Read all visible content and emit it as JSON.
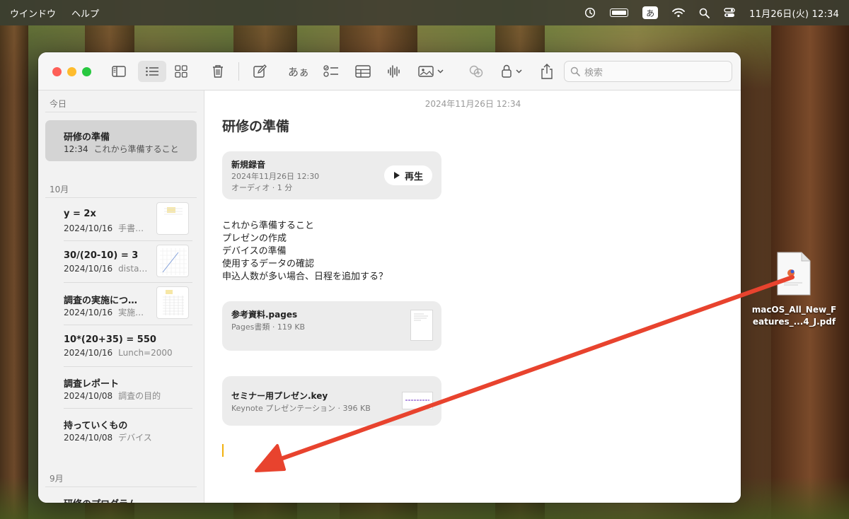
{
  "menubar": {
    "items": [
      "ウインドウ",
      "ヘルプ"
    ],
    "ime": "あ",
    "clock": "11月26日(火)  12:34"
  },
  "toolbar": {
    "format_label": "あぁ",
    "search_placeholder": "検索"
  },
  "sidebar": {
    "sections": {
      "today": "今日",
      "october": "10月",
      "september": "9月"
    },
    "selected_note": {
      "title": "研修の準備",
      "time": "12:34",
      "preview": "これから準備すること"
    },
    "october_notes": [
      {
        "title": "y = 2x",
        "date": "2024/10/16",
        "preview": "手書…"
      },
      {
        "title": "30/(20-10) = 3",
        "date": "2024/10/16",
        "preview": "dista…"
      },
      {
        "title": "調査の実施につ…",
        "date": "2024/10/16",
        "preview": "実施…"
      },
      {
        "title": "10*(20+35) = 550",
        "date": "2024/10/16",
        "preview": "Lunch=2000"
      },
      {
        "title": "調査レポート",
        "date": "2024/10/08",
        "preview": "調査の目的"
      },
      {
        "title": "持っていくもの",
        "date": "2024/10/08",
        "preview": "デバイス"
      }
    ],
    "september_notes": [
      {
        "title": "研修のプログラム"
      }
    ]
  },
  "editor": {
    "date": "2024年11月26日 12:34",
    "title": "研修の準備",
    "audio": {
      "title": "新規録音",
      "date": "2024年11月26日 12:30",
      "meta": "オーディオ · 1 分",
      "play_label": "再生"
    },
    "body_lines": [
      "これから準備すること",
      "プレゼンの作成",
      "デバイスの準備",
      "使用するデータの確認",
      "申込人数が多い場合、日程を追加する？"
    ],
    "attachment1": {
      "title": "参考資料.pages",
      "meta": "Pages書類 · 119 KB"
    },
    "attachment2": {
      "title": "セミナー用プレゼン.key",
      "meta": "Keynote プレゼンテーション · 396 KB"
    }
  },
  "desktop": {
    "file_label_line1": "macOS_All_New_F",
    "file_label_line2": "eatures_...4_J.pdf"
  },
  "colors": {
    "arrow": "#e8432e",
    "selected_note_bg": "#d4d4d4",
    "cursor": "#f2b10e"
  }
}
